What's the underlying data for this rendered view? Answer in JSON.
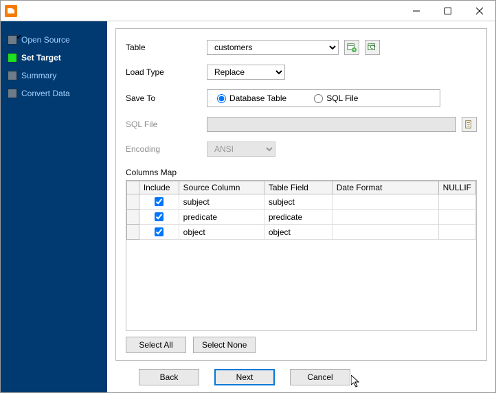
{
  "window": {
    "title": ""
  },
  "nav": {
    "items": [
      {
        "id": "open-source",
        "label": "Open Source",
        "active": false,
        "done": true
      },
      {
        "id": "set-target",
        "label": "Set Target",
        "active": true,
        "done": false
      },
      {
        "id": "summary",
        "label": "Summary",
        "active": false,
        "done": false
      },
      {
        "id": "convert-data",
        "label": "Convert Data",
        "active": false,
        "done": false
      }
    ]
  },
  "form": {
    "table_label": "Table",
    "table_value": "customers",
    "load_label": "Load Type",
    "load_value": "Replace",
    "save_label": "Save To",
    "save_options": {
      "db": "Database Table",
      "sql": "SQL File"
    },
    "save_selected": "db",
    "sqlfile_label": "SQL File",
    "sqlfile_value": "",
    "encoding_label": "Encoding",
    "encoding_value": "ANSI",
    "columns_label": "Columns Map"
  },
  "grid": {
    "headers": {
      "include": "Include",
      "source": "Source Column",
      "field": "Table Field",
      "date": "Date Format",
      "nullif": "NULLIF"
    },
    "rows": [
      {
        "include": true,
        "source": "subject",
        "field": "subject",
        "date": "",
        "nullif": ""
      },
      {
        "include": true,
        "source": "predicate",
        "field": "predicate",
        "date": "",
        "nullif": ""
      },
      {
        "include": true,
        "source": "object",
        "field": "object",
        "date": "",
        "nullif": ""
      }
    ]
  },
  "buttons": {
    "select_all": "Select All",
    "select_none": "Select None",
    "back": "Back",
    "next": "Next",
    "cancel": "Cancel"
  },
  "icons": {
    "table_add": "table-add-icon",
    "table_refresh": "table-refresh-icon",
    "browse": "browse-file-icon"
  }
}
